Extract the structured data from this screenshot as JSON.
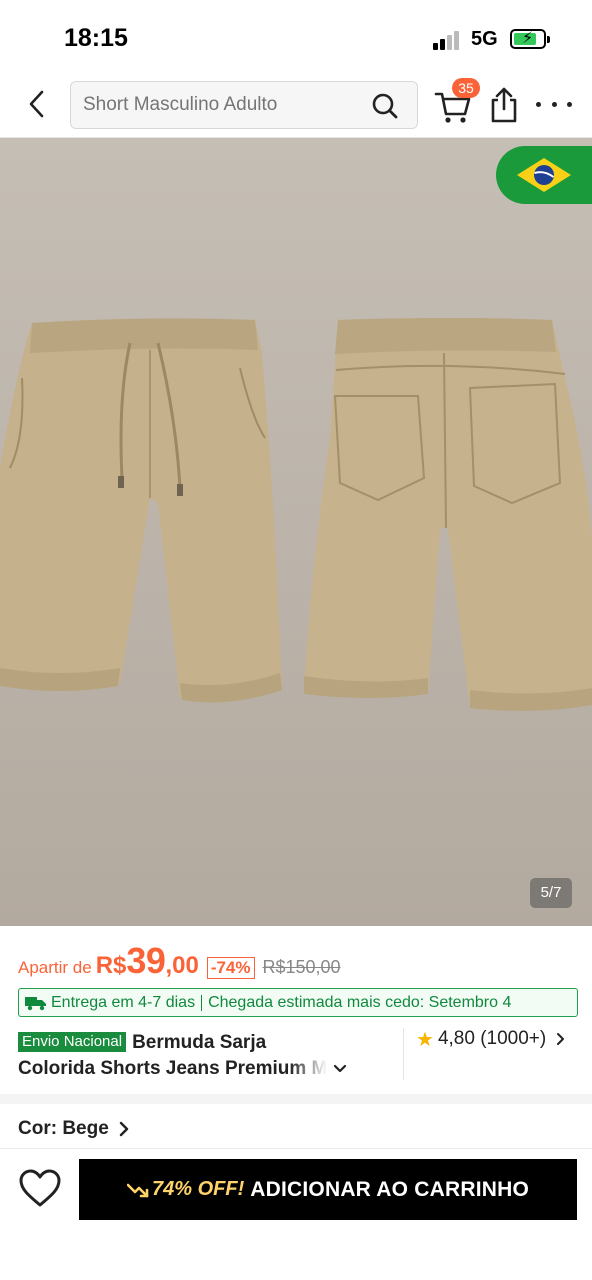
{
  "status_bar": {
    "time": "18:15",
    "network": "5G"
  },
  "search": {
    "placeholder": "Short Masculino Adulto"
  },
  "header": {
    "cart_count": "35"
  },
  "gallery": {
    "counter": "5/7"
  },
  "price": {
    "prefix": "Apartir de",
    "currency": "R$",
    "integer": "39",
    "decimal": ",00",
    "discount": "-74%",
    "original": "R$150,00"
  },
  "delivery": {
    "time": "Entrega em 4-7 dias",
    "estimate": "Chegada estimada mais cedo: Setembro 4"
  },
  "product": {
    "tag": "Envio Nacional",
    "title_line1": "Bermuda Sarja",
    "title_line2": "Colorida Shorts Jeans Premium M"
  },
  "rating": {
    "score": "4,80",
    "count": "(1000+)"
  },
  "variant": {
    "color_label": "Cor: Bege"
  },
  "cta": {
    "promo": "74% OFF!",
    "label": "ADICIONAR AO CARRINHO"
  },
  "colors": {
    "accent": "#fa6338",
    "green": "#198c3d",
    "button": "#000000",
    "promo": "#ffd36a",
    "fabric": "#c4b28f"
  }
}
